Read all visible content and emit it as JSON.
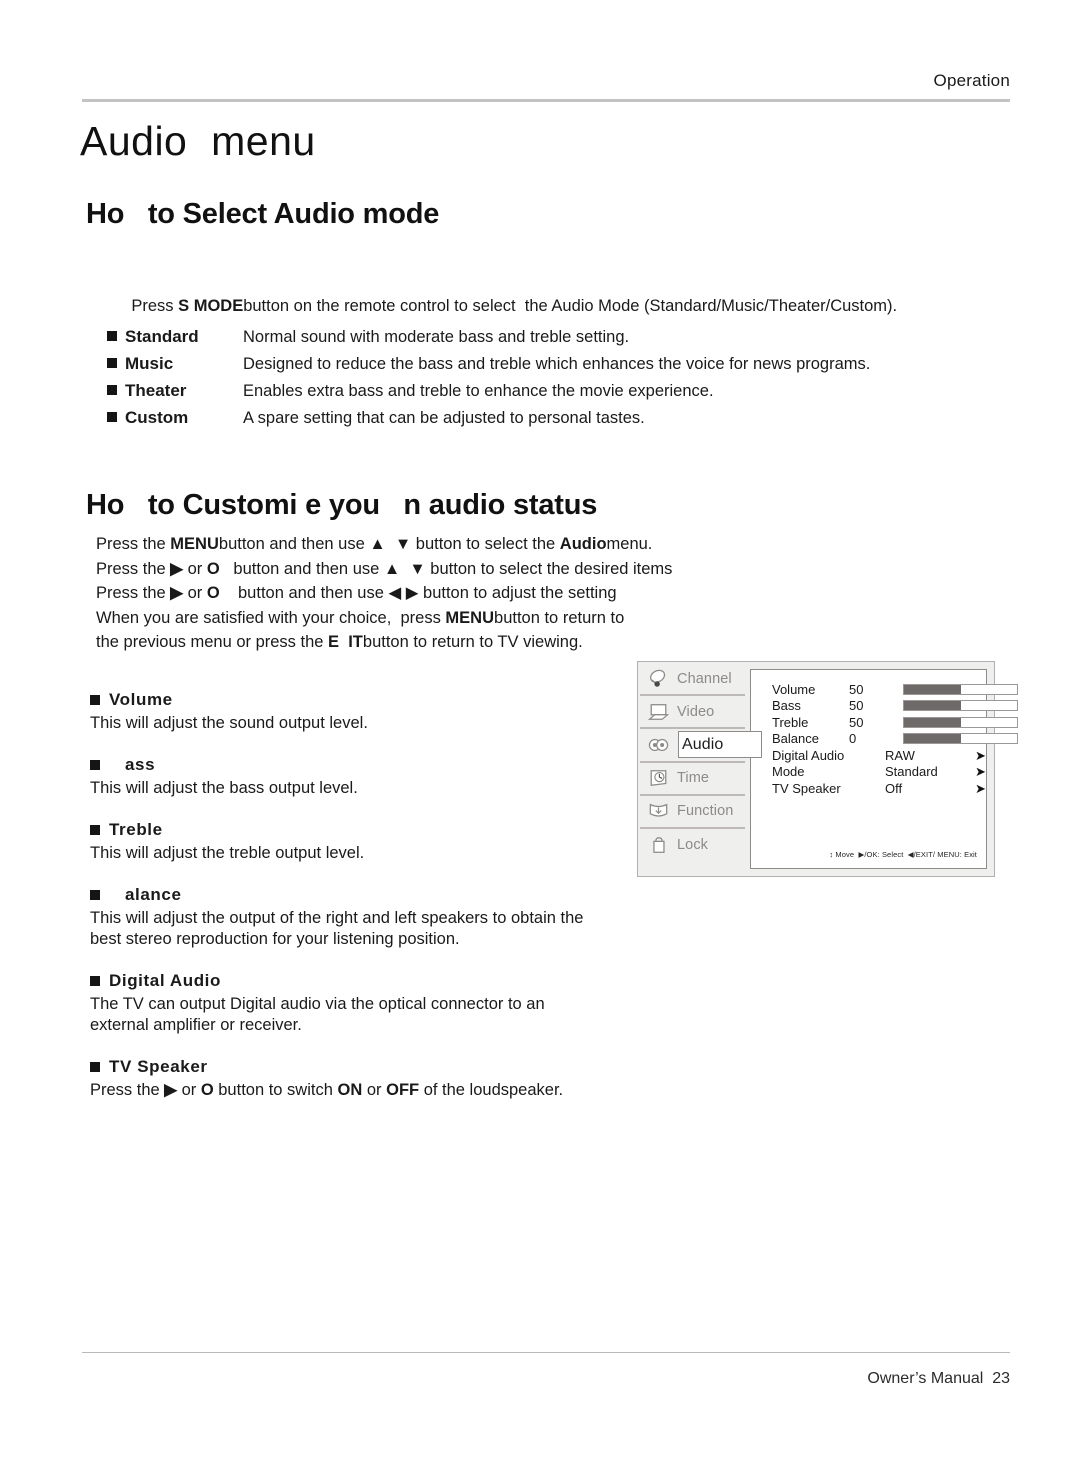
{
  "header": {
    "section_label": "Operation"
  },
  "page_title": "Audio  menu",
  "section1": {
    "heading": "Ho   to Select Audio mode",
    "intro": "Press S MODE button on the remote control to select  the Audio Mode (Standard/Music/Theater/Custom).",
    "modes": [
      {
        "name": "Standard",
        "desc": "Normal sound with moderate bass and treble setting."
      },
      {
        "name": "Music",
        "desc": "Designed to reduce the bass and treble which enhances the voice for news programs."
      },
      {
        "name": "Theater",
        "desc": "Enables extra bass and treble to enhance the movie experience."
      },
      {
        "name": "Custom",
        "desc": "A spare setting that can be adjusted to personal tastes."
      }
    ]
  },
  "section2": {
    "heading": "Ho   to Customi e you   n audio status",
    "steps": [
      "Press the MENU button and then use ▲  ▼ button to select the Audio menu.",
      "Press the ▶ or O   button and then use ▲  ▼ button to select the desired items",
      "Press the ▶ or O   button and then use ◀ ▶ button to adjust the setting",
      "When you are satisfied with your choice,  press MENU button to return to",
      "the previous menu or press the E  IT button to return to TV viewing."
    ],
    "definitions": [
      {
        "title": "Volume",
        "body": "This will adjust the sound output level."
      },
      {
        "title": "   ass",
        "body": "This will adjust the bass output level."
      },
      {
        "title": "Treble",
        "body": "This will adjust the treble output level."
      },
      {
        "title": "   alance",
        "body": "This will adjust the output of the right and left speakers to obtain the\nbest stereo reproduction for your listening position."
      },
      {
        "title": "Digital Audio",
        "body": "The TV can output Digital audio via the optical connector to an\nexternal amplifier or receiver."
      },
      {
        "title": "TV Speaker",
        "body": "Press the ▶ or O   button to switch ON or OFF of the loudspeaker."
      }
    ]
  },
  "osd": {
    "sidebar": [
      {
        "label": "Channel",
        "icon": "satellite-dish-icon",
        "active": false
      },
      {
        "label": "Video",
        "icon": "monitor-icon",
        "active": false
      },
      {
        "label": "Audio",
        "icon": "speakers-icon",
        "active": true
      },
      {
        "label": "Time",
        "icon": "clock-icon",
        "active": false
      },
      {
        "label": "Function",
        "icon": "function-box-icon",
        "active": false
      },
      {
        "label": "Lock",
        "icon": "padlock-icon",
        "active": false
      }
    ],
    "rows": [
      {
        "name": "Volume",
        "value": "50",
        "type": "bar",
        "fill_pct": 50
      },
      {
        "name": "Bass",
        "value": "50",
        "type": "bar",
        "fill_pct": 50
      },
      {
        "name": "Treble",
        "value": "50",
        "type": "bar",
        "fill_pct": 50
      },
      {
        "name": "Balance",
        "value": "0",
        "type": "bar",
        "fill_pct": 50
      },
      {
        "name": "Digital Audio",
        "value": "RAW",
        "type": "arrow",
        "arrow": "➤"
      },
      {
        "name": "Mode",
        "value": "Standard",
        "type": "arrow",
        "arrow": "➤"
      },
      {
        "name": "TV Speaker",
        "value": "Off",
        "type": "arrow",
        "arrow": "➤"
      }
    ],
    "hint": "↕ Move  ▶/OK: Select  ◀/EXIT/ MENU: Exit",
    "colors": {
      "panel_bg": "#efefed",
      "bar_fill": "#6e6a6a",
      "label_gray": "#8e8a8a"
    }
  },
  "footer": {
    "text": "Owner’s Manual  23"
  }
}
